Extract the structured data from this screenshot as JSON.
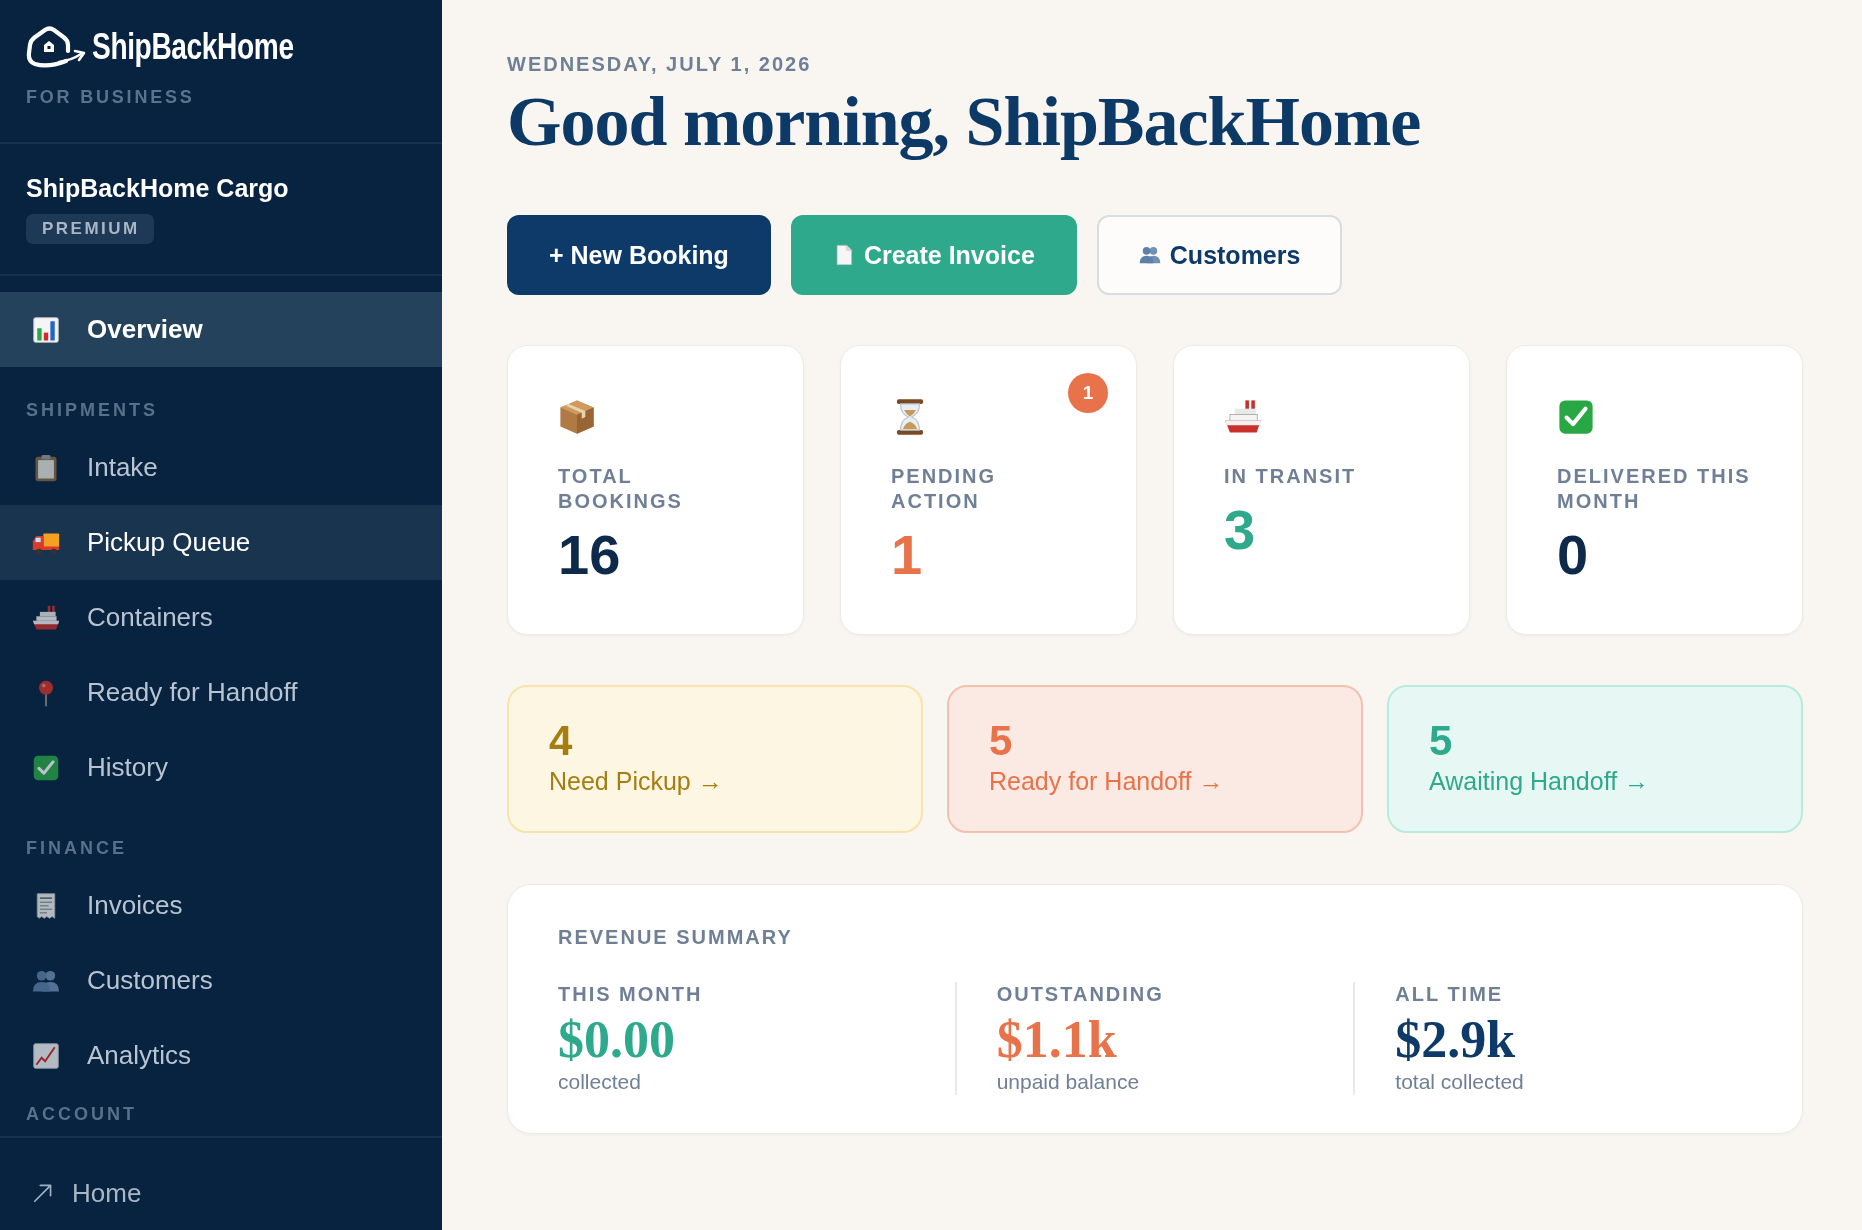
{
  "sidebar": {
    "brand": {
      "name": "ShipBackHome",
      "tagline": "FOR BUSINESS"
    },
    "account": {
      "name": "ShipBackHome Cargo",
      "plan": "PREMIUM"
    },
    "sections": [
      {
        "items": [
          {
            "label": "Overview",
            "selected": true,
            "hovered": false
          }
        ]
      },
      {
        "title": "SHIPMENTS",
        "items": [
          {
            "label": "Intake",
            "selected": false,
            "hovered": false
          },
          {
            "label": "Pickup Queue",
            "selected": false,
            "hovered": true
          },
          {
            "label": "Containers",
            "selected": false,
            "hovered": false
          },
          {
            "label": "Ready for Handoff",
            "selected": false,
            "hovered": false
          },
          {
            "label": "History",
            "selected": false,
            "hovered": false
          }
        ]
      },
      {
        "title": "FINANCE",
        "items": [
          {
            "label": "Invoices",
            "selected": false,
            "hovered": false
          },
          {
            "label": "Customers",
            "selected": false,
            "hovered": false
          },
          {
            "label": "Analytics",
            "selected": false,
            "hovered": false
          }
        ]
      },
      {
        "title": "ACCOUNT"
      }
    ],
    "footer_link": {
      "label": "Home"
    }
  },
  "header": {
    "date": "WEDNESDAY, JULY 1, 2026",
    "greeting": "Good morning, ShipBackHome"
  },
  "actions": [
    {
      "label": "+ New Booking",
      "kind": "primary"
    },
    {
      "label": "Create Invoice",
      "kind": "accent"
    },
    {
      "label": "Customers",
      "kind": "outline"
    }
  ],
  "stats": [
    {
      "label": "TOTAL BOOKINGS",
      "value": "16",
      "color": "#0d2a4a"
    },
    {
      "label": "PENDING ACTION",
      "value": "1",
      "color": "#e8734a",
      "badge": "1"
    },
    {
      "label": "IN TRANSIT",
      "value": "3",
      "color": "#2ea98b"
    },
    {
      "label": "DELIVERED THIS MONTH",
      "value": "0",
      "color": "#0d2a4a"
    }
  ],
  "queues": [
    {
      "count": "4",
      "label": "Need Pickup →",
      "color": "#a57d10"
    },
    {
      "count": "5",
      "label": "Ready for Handoff →",
      "color": "#e8734a"
    },
    {
      "count": "5",
      "label": "Awaiting Handoff →",
      "color": "#2ea98b"
    }
  ],
  "revenue": {
    "title": "REVENUE SUMMARY",
    "columns": [
      {
        "label": "THIS MONTH",
        "value": "$0.00",
        "note": "collected",
        "color": "#2ea98b"
      },
      {
        "label": "OUTSTANDING",
        "value": "$1.1k",
        "note": "unpaid balance",
        "color": "#e8734a"
      },
      {
        "label": "ALL TIME",
        "value": "$2.9k",
        "note": "total collected",
        "color": "#0d3a68"
      }
    ]
  }
}
